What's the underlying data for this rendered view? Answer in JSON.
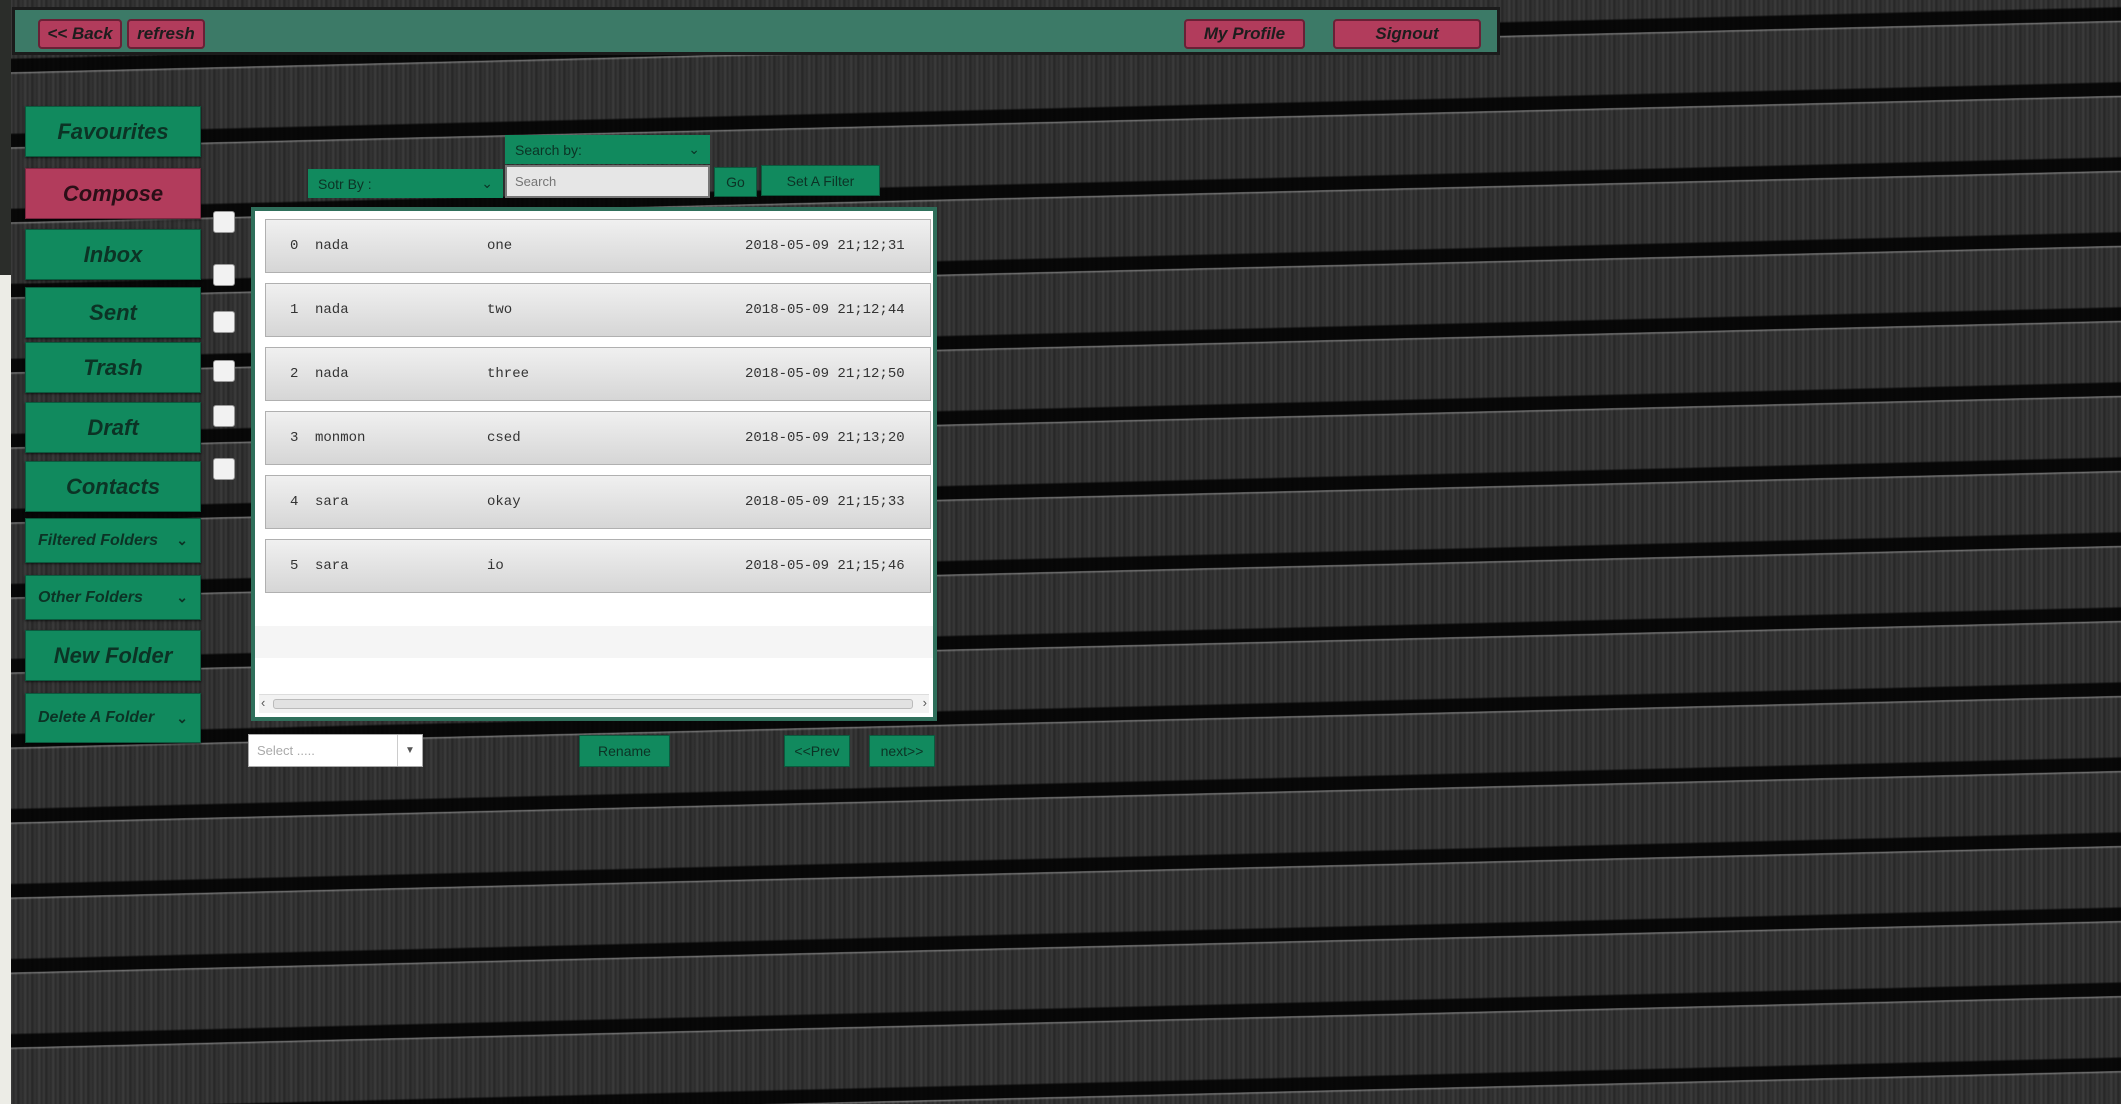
{
  "topbar": {
    "back_label": "<< Back",
    "refresh_label": "refresh",
    "profile_label": "My Profile",
    "signout_label": "Signout"
  },
  "sidebar": {
    "favourites": "Favourites",
    "compose": "Compose",
    "inbox": "Inbox",
    "sent": "Sent",
    "trash": "Trash",
    "draft": "Draft",
    "contacts": "Contacts",
    "filtered_folders": "Filtered Folders",
    "other_folders": "Other Folders",
    "new_folder": "New Folder",
    "delete_folder": "Delete A Folder"
  },
  "toolbar": {
    "search_by": "Search by:",
    "sort_by": "Sotr By :",
    "search_placeholder": "Search",
    "go_label": "Go",
    "filter_label": "Set A Filter"
  },
  "messages": [
    {
      "idx": "0",
      "user": "nada",
      "subject": "one",
      "date": "2018-05-09 21;12;31"
    },
    {
      "idx": "1",
      "user": "nada",
      "subject": "two",
      "date": "2018-05-09 21;12;44"
    },
    {
      "idx": "2",
      "user": "nada",
      "subject": "three",
      "date": "2018-05-09 21;12;50"
    },
    {
      "idx": "3",
      "user": "monmon",
      "subject": "csed",
      "date": "2018-05-09 21;13;20"
    },
    {
      "idx": "4",
      "user": "sara",
      "subject": "okay",
      "date": "2018-05-09 21;15;33"
    },
    {
      "idx": "5",
      "user": "sara",
      "subject": "io",
      "date": "2018-05-09 21;15;46"
    }
  ],
  "bottom": {
    "select_placeholder": "Select .....",
    "rename_label": "Rename",
    "prev_label": "<<Prev",
    "next_label": "next>>"
  },
  "icons": {
    "chevron": "chevron-down-icon",
    "scroll_left": "chevron-left-icon",
    "scroll_right": "chevron-right-icon"
  },
  "colors": {
    "accent_green": "#118a5e",
    "accent_red": "#b23c5c",
    "topbar": "#3c7a67"
  }
}
